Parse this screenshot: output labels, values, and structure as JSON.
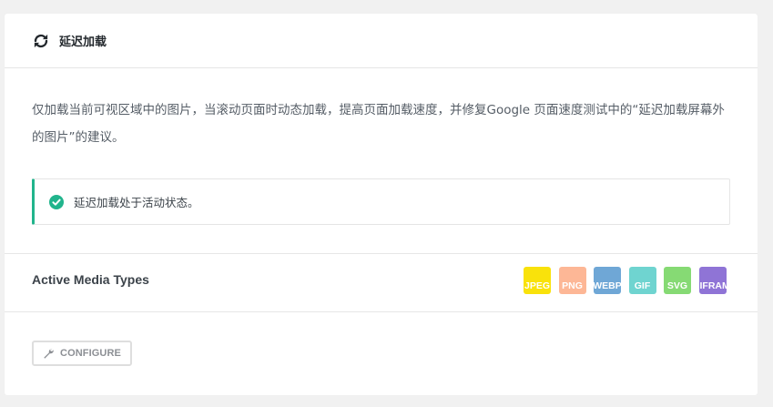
{
  "header": {
    "title": "延迟加载",
    "icon": "sync-icon"
  },
  "description": "仅加载当前可视区域中的图片，当滚动页面时动态加载，提高页面加载速度，并修复Google 页面速度测试中的“延迟加载屏幕外的图片”的建议。",
  "notice": {
    "text": "延迟加载处于活动状态。",
    "icon": "check-circle-icon",
    "color": "#21b48c"
  },
  "media": {
    "label": "Active Media Types",
    "types": [
      {
        "label": "JPEG",
        "color": "#f9e20b"
      },
      {
        "label": "PNG",
        "color": "#fdb796"
      },
      {
        "label": "WEBP",
        "color": "#6fa7d6"
      },
      {
        "label": "GIF",
        "color": "#6fd4d0"
      },
      {
        "label": "SVG",
        "color": "#86da74"
      },
      {
        "label": "IFRAME",
        "color": "#8f74d6"
      }
    ]
  },
  "configure": {
    "label": "CONFIGURE",
    "icon": "wrench-icon"
  }
}
